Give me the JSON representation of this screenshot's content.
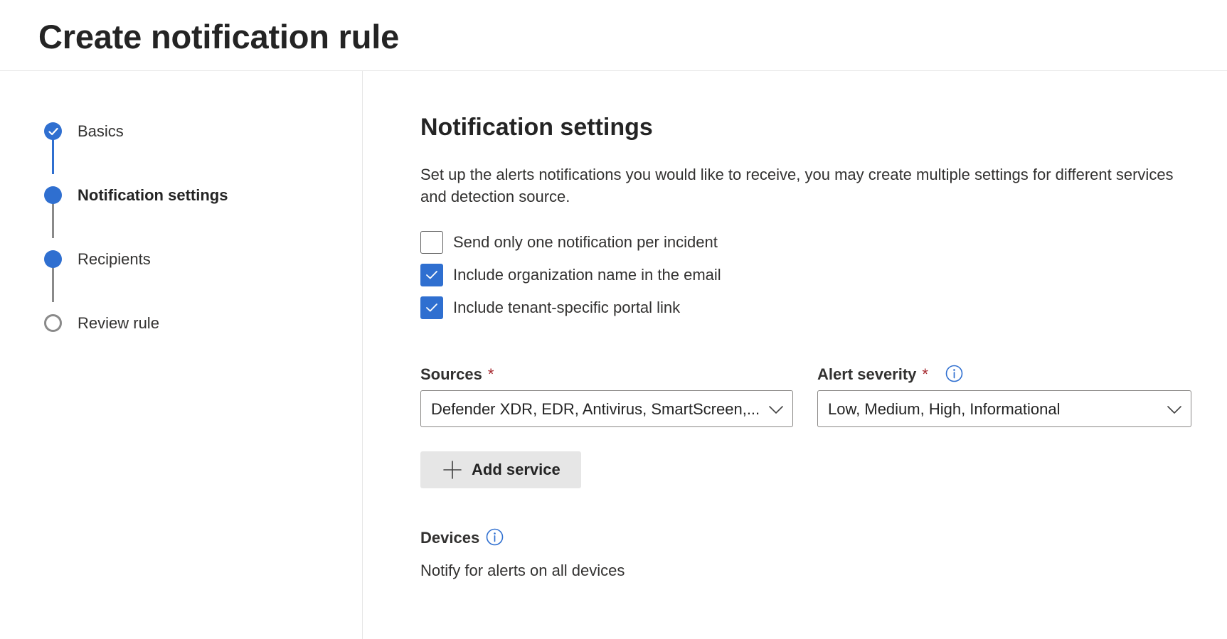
{
  "header": {
    "title": "Create notification rule"
  },
  "steps": [
    {
      "label": "Basics",
      "state": "completed"
    },
    {
      "label": "Notification settings",
      "state": "current"
    },
    {
      "label": "Recipients",
      "state": "upcoming-filled"
    },
    {
      "label": "Review rule",
      "state": "upcoming"
    }
  ],
  "main": {
    "title": "Notification settings",
    "description": "Set up the alerts notifications you would like to receive, you may create multiple settings for different services and detection source.",
    "checkboxes": [
      {
        "label": "Send only one notification per incident",
        "checked": false
      },
      {
        "label": "Include organization name in the email",
        "checked": true
      },
      {
        "label": "Include tenant-specific portal link",
        "checked": true
      }
    ],
    "sources": {
      "label": "Sources",
      "required_mark": "*",
      "value": "Defender XDR, EDR, Antivirus, SmartScreen,..."
    },
    "severity": {
      "label": "Alert severity",
      "required_mark": "*",
      "value": "Low, Medium, High, Informational"
    },
    "add_service_label": "Add service",
    "devices": {
      "label": "Devices",
      "value": "Notify for alerts on all devices"
    }
  },
  "colors": {
    "accent": "#2f6fd0",
    "required": "#a4262c",
    "connector_done": "#2f6fd0",
    "connector_pending": "#8a8a8a"
  },
  "icons": [
    "check-icon",
    "info-icon",
    "chevron-down-icon",
    "plus-icon"
  ]
}
